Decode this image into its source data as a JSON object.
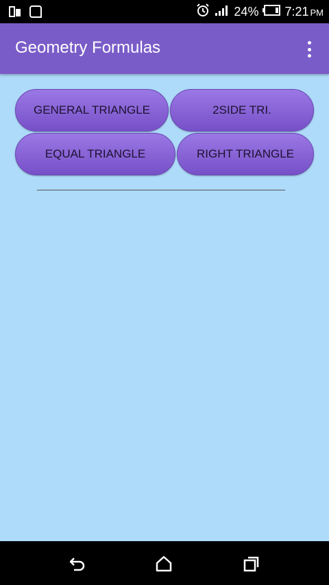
{
  "status_bar": {
    "battery_percent": "24%",
    "time": "7:21",
    "ampm": "PM"
  },
  "app_bar": {
    "title": "Geometry Formulas"
  },
  "buttons": {
    "general_triangle": "GENERAL TRIANGLE",
    "two_side_tri": "2SIDE TRI.",
    "equal_triangle": "EQUAL TRIANGLE",
    "right_triangle": "RIGHT TRIANGLE"
  },
  "colors": {
    "app_bar": "#7a5cc8",
    "background": "#aedbfa",
    "button": "#8a66d8"
  }
}
